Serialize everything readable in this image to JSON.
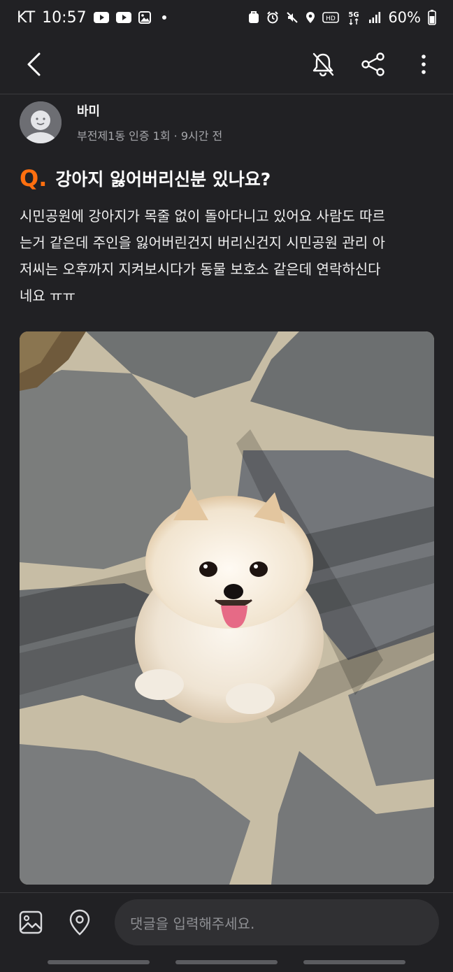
{
  "status_bar": {
    "carrier": "KT",
    "time": "10:57",
    "network": "5G",
    "hd_badge": "HD",
    "battery": "60%",
    "left_icons": [
      "youtube-icon",
      "youtube-icon",
      "gallery-icon",
      "dot-icon"
    ],
    "right_icons": [
      "app-icon",
      "alarm-icon",
      "mute-icon",
      "location-icon",
      "hd-voice-icon",
      "5g-icon",
      "signal-icon",
      "battery-icon"
    ]
  },
  "app_bar": {
    "icons": [
      "back-icon",
      "notification-off-icon",
      "share-icon",
      "more-icon"
    ]
  },
  "author": {
    "name": "바미",
    "meta": "부전제1동 인증 1회 · 9시간 전"
  },
  "post": {
    "q_mark": "Q.",
    "title": "강아지 잃어버리신분 있나요?",
    "body_lines": [
      "시민공원에 강아지가 목줄 없이 돌아다니고 있어요 사람도 따르",
      "는거 같은데 주인을 잃어버린건지 버리신건지 시민공원 관리 아",
      "저씨는 오후까지 지켜보시다가 동물 보호소 같은데 연락하신다",
      "네요 ㅠㅠ"
    ]
  },
  "comment_bar": {
    "placeholder": "댓글을 입력해주세요.",
    "icons": [
      "image-icon",
      "location-pin-icon"
    ]
  },
  "colors": {
    "background": "#212124",
    "accent": "#ff6f0f",
    "input_bg": "#303033",
    "muted_text": "#a6a7ab"
  }
}
